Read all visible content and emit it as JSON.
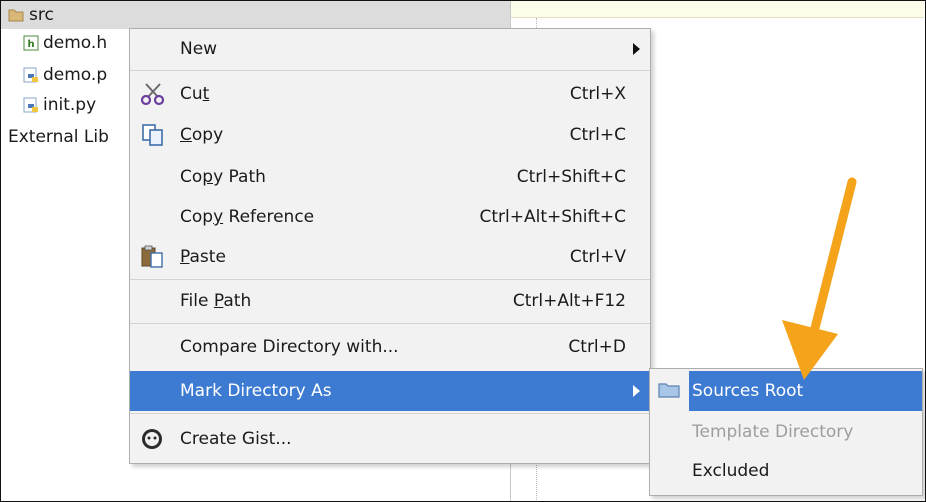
{
  "project_tree": {
    "items": [
      {
        "label": "src",
        "icon": "folder-icon"
      },
      {
        "label": "demo.h",
        "icon": "html-file-icon"
      },
      {
        "label": "demo.p",
        "icon": "python-file-icon"
      },
      {
        "label": "init.py",
        "icon": "python-file-icon"
      },
      {
        "label": "External Lib",
        "icon": ""
      }
    ]
  },
  "context_menu": {
    "new": "New",
    "cut": {
      "label_pre": "Cu",
      "label_ul": "t",
      "shortcut": "Ctrl+X"
    },
    "copy": {
      "label_ul": "C",
      "label_post": "opy",
      "shortcut": "Ctrl+C"
    },
    "copy_path": {
      "label_pre": "Co",
      "label_ul": "p",
      "label_post": "y Path",
      "shortcut": "Ctrl+Shift+C"
    },
    "copy_reference": {
      "label_pre": "Cop",
      "label_ul": "y",
      "label_post": " Reference",
      "shortcut": "Ctrl+Alt+Shift+C"
    },
    "paste": {
      "label_ul": "P",
      "label_post": "aste",
      "shortcut": "Ctrl+V"
    },
    "file_path": {
      "label_pre": "File ",
      "label_ul": "P",
      "label_post": "ath",
      "shortcut": "Ctrl+Alt+F12"
    },
    "compare": {
      "label": "Compare Directory with...",
      "shortcut": "Ctrl+D"
    },
    "mark_as": "Mark Directory As",
    "create_gist": "Create Gist..."
  },
  "submenu": {
    "sources_root": "Sources Root",
    "template_directory": "Template Directory",
    "excluded": "Excluded"
  },
  "colors": {
    "highlight": "#3d7bd2",
    "annotation_arrow": "#f5a31a"
  }
}
